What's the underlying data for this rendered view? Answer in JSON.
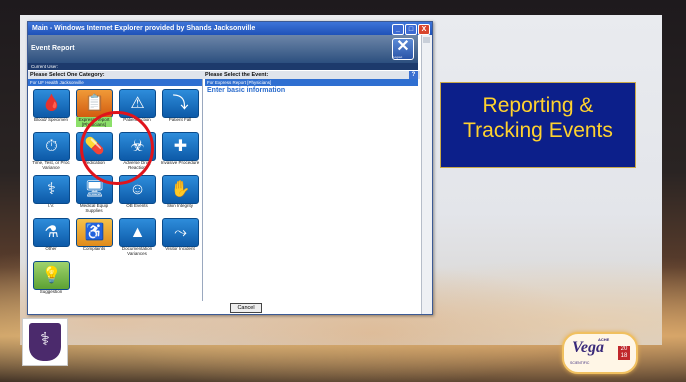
{
  "window": {
    "title": "Main - Windows Internet Explorer provided by Shands Jacksonville",
    "controls": [
      "_",
      "□",
      "X"
    ]
  },
  "app": {
    "header_title": "Event Report",
    "current_user_label": "Current User:",
    "logout_label": "Logout",
    "logout_glyph": "✕"
  },
  "prompts": {
    "category": "Please Select One Category:",
    "event": "Please Select the Event:",
    "help": "?"
  },
  "left_pane": {
    "header": "For UF Health Jacksonville"
  },
  "right_pane": {
    "header": "For Express Report [Physicians]",
    "body": "Enter basic information"
  },
  "categories": [
    {
      "label": "Blood/ Specimen",
      "icon": "blood-bag-icon",
      "glyph": "🩸"
    },
    {
      "label": "Express Report [Physicians]",
      "icon": "report-icon",
      "glyph": "📋",
      "selected": true
    },
    {
      "label": "Patient Action",
      "icon": "warning-icon",
      "glyph": "⚠"
    },
    {
      "label": "Patient Fall",
      "icon": "fall-icon",
      "glyph": "⤵"
    },
    {
      "label": "Time, Test, or Proc Variance",
      "icon": "procedure-icon",
      "glyph": "⏱"
    },
    {
      "label": "Medication",
      "icon": "medication-icon",
      "glyph": "💊"
    },
    {
      "label": "Adverse Drug Reaction",
      "icon": "drug-reaction-icon",
      "glyph": "☣"
    },
    {
      "label": "Invasive Procedure",
      "icon": "surgery-icon",
      "glyph": "✚"
    },
    {
      "label": "I.V.",
      "icon": "iv-pole-icon",
      "glyph": "⚕"
    },
    {
      "label": "Medical Equip Supplies",
      "icon": "equipment-icon",
      "glyph": "🖥"
    },
    {
      "label": "OB Events",
      "icon": "baby-icon",
      "glyph": "☺"
    },
    {
      "label": "Skin Integrity",
      "icon": "skin-icon",
      "glyph": "✋"
    },
    {
      "label": "Other",
      "icon": "lab-flask-icon",
      "glyph": "⚗"
    },
    {
      "label": "Complaints",
      "icon": "wheelchair-icon",
      "glyph": "♿",
      "tone": "comp"
    },
    {
      "label": "Documentation Variances",
      "icon": "alert-triangle-icon",
      "glyph": "▲"
    },
    {
      "label": "Visitor Incident",
      "icon": "visitor-fall-icon",
      "glyph": "⤳"
    },
    {
      "label": "Suggestion",
      "icon": "lightbulb-icon",
      "glyph": "💡",
      "tone": "sug"
    }
  ],
  "buttons": {
    "cancel": "Cancel"
  },
  "slide": {
    "callout": "Reporting & Tracking Events"
  },
  "logos": {
    "left": "university-crest-logo",
    "right": {
      "name": "Vega",
      "small": "ACHE",
      "sub": "SCIENTIFIC",
      "badge": "20 18"
    }
  },
  "colors": {
    "callout_bg": "#0c1f8a",
    "callout_text": "#ffd22e",
    "highlight_circle": "#e0141c",
    "tile_blue": "#1a70c4",
    "selected_tile": "#e7782a"
  }
}
